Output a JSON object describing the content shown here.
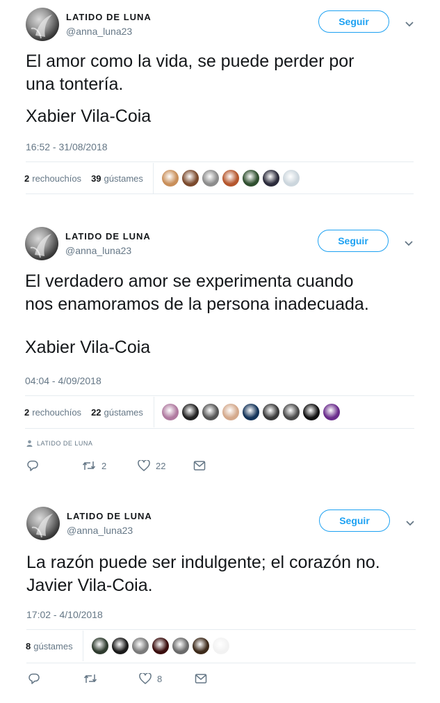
{
  "tweets": [
    {
      "name": "LATIDO DE LUNA",
      "handle": "@anna_luna23",
      "follow_label": "Seguir",
      "text": "El amor como la vida, se puede perder por\nuna tontería.",
      "author": "Xabier Vila-Coia",
      "time": "16:52 - 31/08/2018",
      "retweets": "2",
      "retweets_label": "rechouchíos",
      "likes": "39",
      "likes_label": "gústames",
      "liker_colors": [
        "#c98f5a",
        "#7b4a2d",
        "#8c8c8c",
        "#b5562d",
        "#2f4f2f",
        "#2b2b3b",
        "#ccd6dd"
      ]
    },
    {
      "name": "LATIDO DE LUNA",
      "handle": "@anna_luna23",
      "follow_label": "Seguir",
      "text": "El verdadero amor se experimenta cuando\nnos enamoramos de la persona inadecuada.",
      "author": "Xabier Vila-Coia",
      "time": "04:04 - 4/09/2018",
      "retweets": "2",
      "retweets_label": "rechouchíos",
      "likes": "22",
      "likes_label": "gústames",
      "liker_colors": [
        "#b07aa0",
        "#222222",
        "#555555",
        "#d4a98c",
        "#14345a",
        "#3a3a3a",
        "#4a4a4a",
        "#111111",
        "#6a2c8c"
      ],
      "context_label": "LATIDO DE LUNA",
      "action_retweets": "2",
      "action_likes": "22"
    },
    {
      "name": "LATIDO DE LUNA",
      "handle": "@anna_luna23",
      "follow_label": "Seguir",
      "text": "La razón puede ser indulgente; el corazón no.\nJavier Vila-Coia.",
      "time": "17:02 - 4/10/2018",
      "likes": "8",
      "likes_label": "gústames",
      "liker_colors": [
        "#2e3b2e",
        "#1a1a1a",
        "#7a7a7a",
        "#3a0d0d",
        "#6a6a6a",
        "#3d2a1a",
        "#f2f2f2"
      ],
      "action_likes": "8"
    }
  ],
  "icons": {
    "chevron": "chevron-down-icon",
    "reply": "reply-icon",
    "retweet": "retweet-icon",
    "like": "heart-icon",
    "dm": "envelope-icon",
    "person": "person-icon"
  }
}
